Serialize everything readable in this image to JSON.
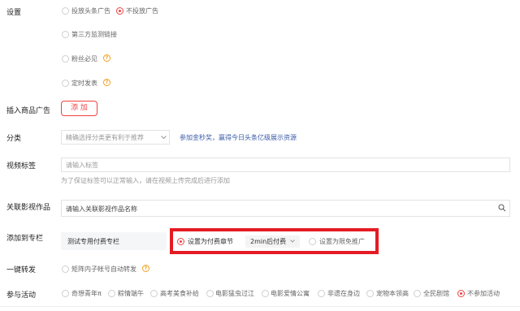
{
  "settings": {
    "label": "设置",
    "ad_option_1": "投放头条广告",
    "ad_option_2": "不投放广告",
    "third_party": "第三方监测链接",
    "fans_only": "粉丝必见",
    "scheduled": "定时发表"
  },
  "insert_ad": {
    "label": "插入商品广告",
    "add_button": "添 加"
  },
  "category": {
    "label": "分类",
    "placeholder": "精确选择分类更有利于推荐",
    "promo_link": "参加金秒奖，赢得今日头条亿级展示资源"
  },
  "video_tags": {
    "label": "视频标签",
    "placeholder": "请输入标签",
    "hint": "为了保证标签可以正常输入，请在视频上传完成后进行添加"
  },
  "related_work": {
    "label": "关联影视作品",
    "placeholder": "请输入关联影视作品名称"
  },
  "column": {
    "label": "添加到专栏",
    "name": "测试专用付费专栏",
    "option_paid": "设置为付费章节",
    "paid_select": "2min后付费",
    "option_free": "设置为限免推广"
  },
  "repost": {
    "label": "一键转发",
    "option": "矩阵内子帐号自动转发"
  },
  "activity": {
    "label": "参与活动",
    "options": [
      "奇想青年π",
      "粽情端午",
      "高考美食补给",
      "电影猛虫过江",
      "电影爱情公寓",
      "非遗在身边",
      "宠物本领高",
      "全民剧馆",
      "不参加活动"
    ]
  },
  "colors": {
    "accent": "#f04142",
    "highlight_border": "#e51b24",
    "link": "#3a5ba8",
    "help_icon": "#f0a020"
  },
  "icons": {
    "help": "?"
  }
}
